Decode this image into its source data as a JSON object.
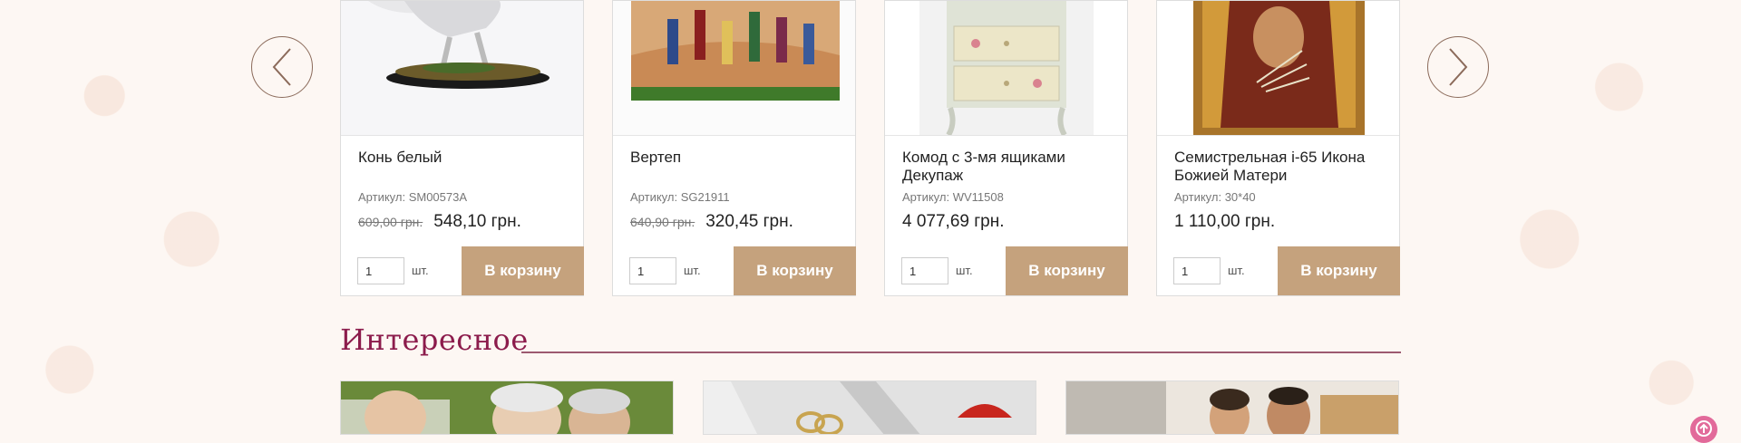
{
  "products": [
    {
      "title": "Конь белый",
      "sku": "Артикул: SM00573A",
      "old_price": "609,00 грн.",
      "price": "548,10 грн.",
      "qty": "1",
      "unit": "шт.",
      "cart_label": "В корзину"
    },
    {
      "title": "Вертеп",
      "sku": "Артикул: SG21911",
      "old_price": "640,90 грн.",
      "price": "320,45 грн.",
      "qty": "1",
      "unit": "шт.",
      "cart_label": "В корзину"
    },
    {
      "title": "Комод с 3-мя ящиками Декупаж",
      "sku": "Артикул: WV11508",
      "old_price": "",
      "price": "4 077,69 грн.",
      "qty": "1",
      "unit": "шт.",
      "cart_label": "В корзину"
    },
    {
      "title": "Семистрельная i-65 Икона Божией Матери",
      "sku": "Артикул: 30*40",
      "old_price": "",
      "price": "1 110,00 грн.",
      "qty": "1",
      "unit": "шт.",
      "cart_label": "В корзину"
    }
  ],
  "section": {
    "title": "Интересное"
  },
  "icons": {
    "prev": "chevron-left-icon",
    "next": "chevron-right-icon",
    "scroll_top": "arrow-up-icon"
  },
  "colors": {
    "accent": "#c5a27d",
    "section_title": "#8c1c4c",
    "scroll_top": "#e26a9a"
  }
}
